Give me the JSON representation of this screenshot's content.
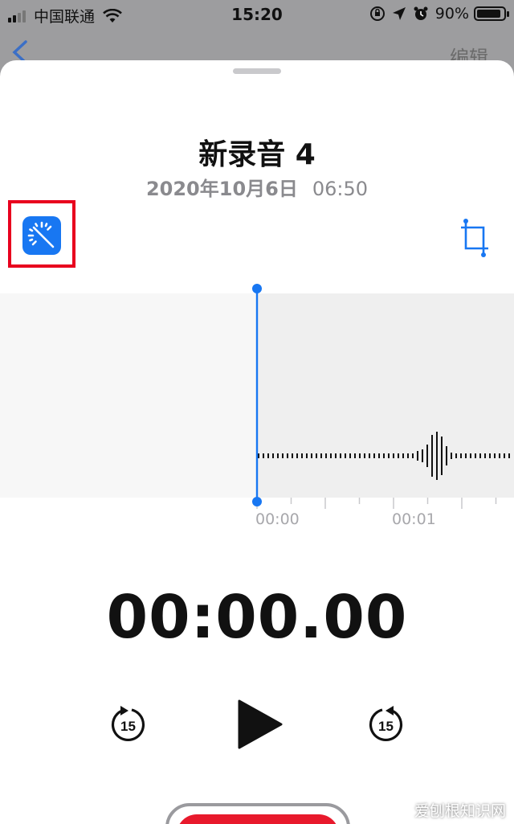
{
  "status_bar": {
    "carrier": "中国联通",
    "time": "15:20",
    "battery_percent": "90%",
    "battery_level": 0.9,
    "icons": [
      "signal-icon",
      "wifi-icon",
      "orientation-lock-icon",
      "location-icon",
      "alarm-icon",
      "battery-icon"
    ]
  },
  "nav": {
    "back_icon": "chevron-left-icon",
    "edit_label": "编辑"
  },
  "recording": {
    "title": "新录音 4",
    "date": "2020年10月6日",
    "time": "06:50"
  },
  "toolbar": {
    "enhance_icon": "magic-wand-icon",
    "crop_icon": "crop-icon"
  },
  "timeline": {
    "labels": [
      "00:00",
      "00:01"
    ]
  },
  "player": {
    "elapsed": "00:00.00",
    "skip_back_seconds": "15",
    "skip_forward_seconds": "15",
    "play_icon": "play-icon"
  },
  "colors": {
    "accent": "#1877f2",
    "record": "#e8192c",
    "highlight": "#e8001e"
  },
  "watermark": "爱刨根知识网"
}
